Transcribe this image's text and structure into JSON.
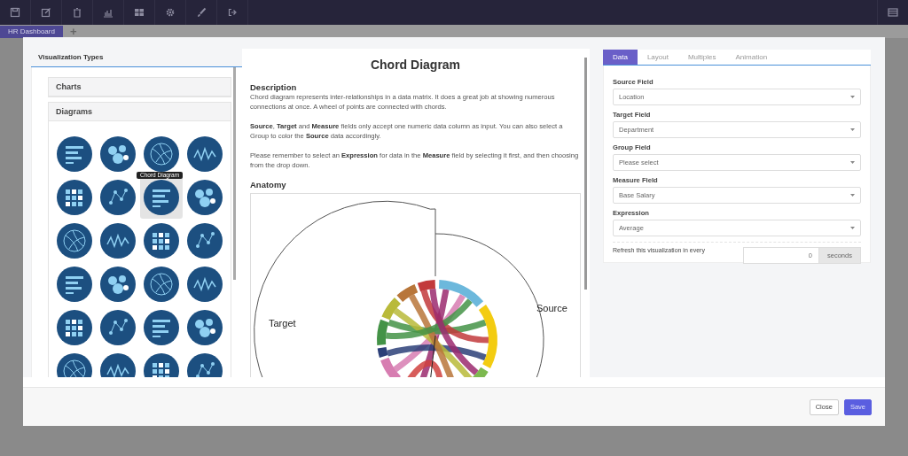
{
  "toolbar": {
    "dashboard_tabs": [
      {
        "label": "HR Dashboard",
        "selected": true
      }
    ],
    "add_tab": "+"
  },
  "modal": {
    "left_panel": {
      "title": "Visualization Types",
      "sections": [
        {
          "title": "Charts",
          "expanded": false
        },
        {
          "title": "Diagrams",
          "expanded": true
        }
      ],
      "tooltip": "Chord Diagram",
      "diagram_types": [
        {
          "selected": false
        },
        {
          "selected": false
        },
        {
          "selected": false
        },
        {
          "selected": false
        },
        {
          "selected": false
        },
        {
          "selected": false
        },
        {
          "selected": true
        },
        {
          "selected": false
        },
        {
          "selected": false
        },
        {
          "selected": false
        },
        {
          "selected": false
        },
        {
          "selected": false
        },
        {
          "selected": false
        },
        {
          "selected": false
        },
        {
          "selected": false
        },
        {
          "selected": false
        },
        {
          "selected": false
        },
        {
          "selected": false
        },
        {
          "selected": false
        },
        {
          "selected": false
        },
        {
          "selected": false
        },
        {
          "selected": false
        },
        {
          "selected": false
        },
        {
          "selected": false
        }
      ]
    },
    "middle_panel": {
      "title": "Chord Diagram",
      "description_heading": "Description",
      "paragraphs": [
        "Chord diagram represents inter-relationships in a data matrix. It does a great job at showing numerous connections at once. A wheel of points are connected with chords.",
        "**Source**, **Target** and **Measure** fields only accept one numeric data column as input. You can also select a Group to color the **Source** data accordingly.",
        "Please remember to select an **Expression** for data in the **Measure** field by selecting it first, and then choosing from the drop down."
      ],
      "anatomy_heading": "Anatomy",
      "anatomy_labels": {
        "target": "Target",
        "source": "Source"
      }
    },
    "right_panel": {
      "tabs": [
        {
          "label": "Data",
          "selected": true
        },
        {
          "label": "Layout",
          "selected": false
        },
        {
          "label": "Multiples",
          "selected": false
        },
        {
          "label": "Animation",
          "selected": false
        }
      ],
      "fields": [
        {
          "label": "Source Field",
          "value": "Location"
        },
        {
          "label": "Target Field",
          "value": "Department"
        },
        {
          "label": "Group Field",
          "value": "Please select"
        },
        {
          "label": "Measure Field",
          "value": "Base Salary"
        },
        {
          "label": "Expression",
          "value": "Average"
        }
      ],
      "refresh": {
        "label": "Refresh this visualization in every",
        "value": "0",
        "unit": "seconds"
      }
    },
    "footer_buttons": [
      {
        "label": "Close",
        "kind": "secondary"
      },
      {
        "label": "Save",
        "kind": "primary"
      }
    ]
  }
}
